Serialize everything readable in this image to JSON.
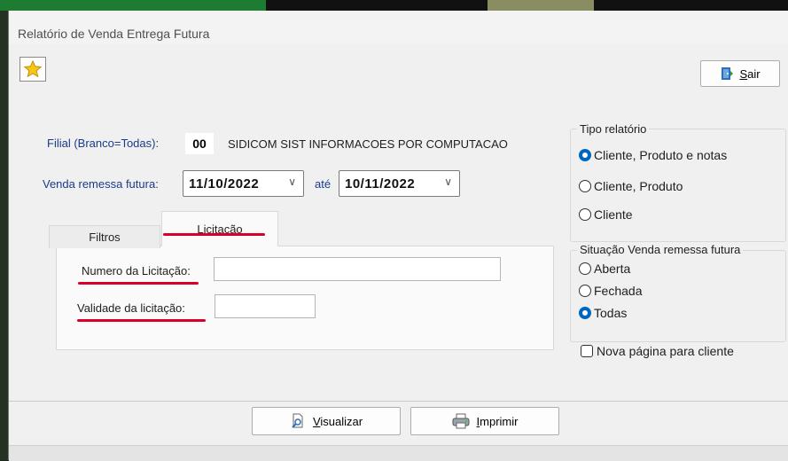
{
  "window": {
    "title": "Relatório de Venda Entrega Futura"
  },
  "toolbar": {
    "favorite_icon": "star-icon",
    "exit_label": "Sair",
    "exit_icon": "exit-door-icon"
  },
  "filters": {
    "filial_label": "Filial (Branco=Todas):",
    "filial_code": "00",
    "filial_name": "SIDICOM SIST INFORMACOES POR COMPUTACAO",
    "date_label": "Venda remessa futura:",
    "date_from": "11/10/2022",
    "date_sep": "até",
    "date_to": "10/11/2022"
  },
  "tabs": [
    {
      "label": "Filtros",
      "active": false
    },
    {
      "label": "Licitação",
      "active": true
    }
  ],
  "licitacao": {
    "numero_label": "Numero da Licitação:",
    "numero_value": "",
    "validade_label": "Validade da licitação:",
    "validade_value": ""
  },
  "tipo_relatorio": {
    "title": "Tipo relatório",
    "options": [
      {
        "label": "Cliente, Produto e notas",
        "selected": true
      },
      {
        "label": "Cliente, Produto",
        "selected": false
      },
      {
        "label": "Cliente",
        "selected": false
      }
    ]
  },
  "situacao": {
    "title": "Situação Venda remessa futura",
    "options": [
      {
        "label": "Aberta",
        "selected": false
      },
      {
        "label": "Fechada",
        "selected": false
      },
      {
        "label": "Todas",
        "selected": true
      }
    ]
  },
  "nova_pagina": {
    "label": "Nova página para cliente",
    "checked": false
  },
  "actions": {
    "visualizar_label": "Visualizar",
    "imprimir_label": "Imprimir"
  },
  "colors": {
    "accent": "#0067c0",
    "highlight_red": "#d8002a",
    "label_blue": "#1a3b8a"
  }
}
